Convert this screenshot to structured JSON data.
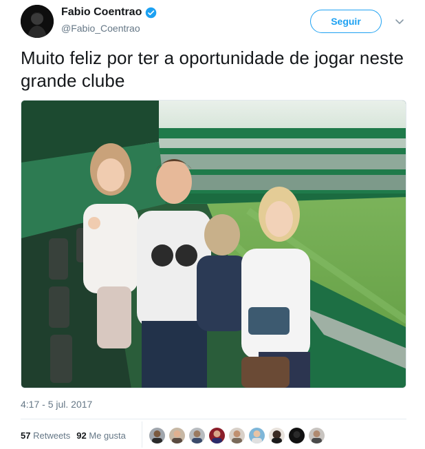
{
  "user": {
    "display_name": "Fabio Coentrao",
    "handle": "@Fabio_Coentrao",
    "avatar_icon": "profile-photo",
    "verified_icon": "verified-badge-icon"
  },
  "follow_button": {
    "label": "Seguir"
  },
  "caret_icon": "chevron-down-icon",
  "tweet": {
    "text": "Muito feliz por ter a oportunidade de jogar neste grande clube",
    "timestamp": "4:17 - 5 jul. 2017"
  },
  "stats": {
    "retweets_count": "57",
    "retweets_label": "Retweets",
    "likes_count": "92",
    "likes_label": "Me gusta"
  },
  "colors": {
    "accent": "#1da1f2",
    "secondary_text": "#657786",
    "stadium_green": "#1f7a4a",
    "pitch_green": "#6fa84a"
  }
}
